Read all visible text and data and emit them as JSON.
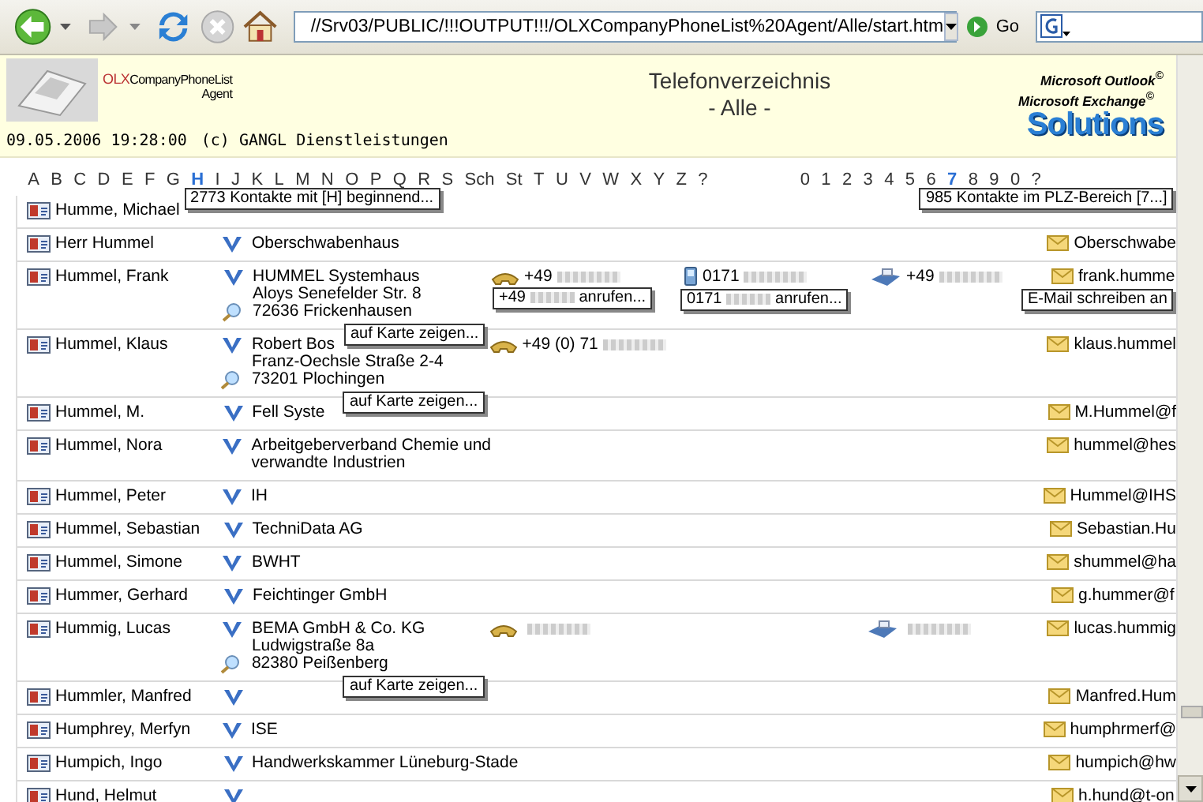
{
  "toolbar": {
    "address": "//Srv03/PUBLIC/!!!OUTPUT!!!/OLXCompanyPhoneList%20Agent/Alle/start.htm",
    "go": "Go"
  },
  "header": {
    "brand_prefix": "OLX",
    "brand": "CompanyPhoneList",
    "brand_sub": "Agent",
    "title": "Telefonverzeichnis",
    "subtitle": "- Alle -",
    "timestamp": "09.05.2006 19:28:00",
    "copyright": "(c) GANGL Dienstleistungen",
    "partner_lines": [
      "Microsoft Outlook$^{©}$",
      "Microsoft Exchange$^{©}$"
    ],
    "partner_name": "Solutions"
  },
  "letters": [
    {
      "label": "A",
      "selected": false
    },
    {
      "label": "B",
      "selected": false
    },
    {
      "label": "C",
      "selected": false
    },
    {
      "label": "D",
      "selected": false
    },
    {
      "label": "E",
      "selected": false
    },
    {
      "label": "F",
      "selected": false
    },
    {
      "label": "G",
      "selected": false
    },
    {
      "label": "H",
      "selected": true,
      "tooltip": "2773 Kontakte mit [H] beginnend..."
    },
    {
      "label": "I",
      "selected": false
    },
    {
      "label": "J",
      "selected": false
    },
    {
      "label": "K",
      "selected": false
    },
    {
      "label": "L",
      "selected": false
    },
    {
      "label": "M",
      "selected": false
    },
    {
      "label": "N",
      "selected": false
    },
    {
      "label": "O",
      "selected": false
    },
    {
      "label": "P",
      "selected": false
    },
    {
      "label": "Q",
      "selected": false
    },
    {
      "label": "R",
      "selected": false
    },
    {
      "label": "S",
      "selected": false
    },
    {
      "label": "Sch",
      "selected": false
    },
    {
      "label": "St",
      "selected": false
    },
    {
      "label": "T",
      "selected": false
    },
    {
      "label": "U",
      "selected": false
    },
    {
      "label": "V",
      "selected": false
    },
    {
      "label": "W",
      "selected": false
    },
    {
      "label": "X",
      "selected": false
    },
    {
      "label": "Y",
      "selected": false
    },
    {
      "label": "Z",
      "selected": false
    },
    {
      "label": "?",
      "selected": false
    }
  ],
  "digits": [
    {
      "label": "0",
      "selected": false
    },
    {
      "label": "1",
      "selected": false
    },
    {
      "label": "2",
      "selected": false
    },
    {
      "label": "3",
      "selected": false
    },
    {
      "label": "4",
      "selected": false
    },
    {
      "label": "5",
      "selected": false
    },
    {
      "label": "6",
      "selected": false
    },
    {
      "label": "7",
      "selected": true,
      "tooltip": "985 Kontakte im PLZ-Bereich [7...]"
    },
    {
      "label": "8",
      "selected": false
    },
    {
      "label": "9",
      "selected": false
    },
    {
      "label": "0",
      "selected": false
    },
    {
      "label": "?",
      "selected": false
    }
  ],
  "contacts": [
    {
      "name": "Humme, Michael"
    },
    {
      "name": "Herr Hummel",
      "company": {
        "lines": [
          "Oberschwabenhaus"
        ],
        "map": false
      },
      "email": {
        "text": "Oberschwabe"
      }
    },
    {
      "name": "Hummel, Frank",
      "company": {
        "lines": [
          "HUMMEL Systemhaus",
          "Aloys Senefelder Str. 8",
          "72636 Frickenhausen"
        ],
        "map": true,
        "map_tooltip": "auf Karte zeigen..."
      },
      "phone": {
        "text": "+49",
        "redacted": true,
        "tooltip": {
          "text": "+49",
          "redacted": true,
          "suffix": "anrufen..."
        }
      },
      "mobile": {
        "text": "0171",
        "redacted": true,
        "tooltip": {
          "text": "0171",
          "redacted": true,
          "suffix": "anrufen..."
        }
      },
      "fax": {
        "text": "+49",
        "redacted": true
      },
      "email": {
        "text": "frank.humme",
        "tooltip": "E-Mail schreiben an"
      }
    },
    {
      "name": "Hummel, Klaus",
      "company": {
        "lines": [
          "Robert Bos",
          "Franz-Oechsle Straße 2-4",
          "73201 Plochingen"
        ],
        "map": true,
        "map_tooltip": "auf Karte zeigen..."
      },
      "phone": {
        "text": "+49 (0) 71",
        "redacted": true
      },
      "email": {
        "text": "klaus.hummel"
      }
    },
    {
      "name": "Hummel, M.",
      "company": {
        "lines": [
          "Fell Syste"
        ],
        "map": false
      },
      "email": {
        "text": "M.Hummel@f"
      }
    },
    {
      "name": "Hummel, Nora",
      "company": {
        "lines": [
          "Arbeitgeberverband Chemie und",
          "verwandte Industrien"
        ],
        "map": false
      },
      "email": {
        "text": "hummel@hes"
      }
    },
    {
      "name": "Hummel, Peter",
      "company": {
        "lines": [
          "IH"
        ],
        "map": false
      },
      "email": {
        "text": "Hummel@IHS"
      }
    },
    {
      "name": "Hummel, Sebastian",
      "company": {
        "lines": [
          "TechniData AG"
        ],
        "map": false
      },
      "email": {
        "text": "Sebastian.Hu"
      }
    },
    {
      "name": "Hummel, Simone",
      "company": {
        "lines": [
          "BWHT"
        ],
        "map": false
      },
      "email": {
        "text": "shummel@ha"
      }
    },
    {
      "name": "Hummer, Gerhard",
      "company": {
        "lines": [
          "Feichtinger GmbH"
        ],
        "map": false
      },
      "email": {
        "text": "g.hummer@f"
      }
    },
    {
      "name": "Hummig, Lucas",
      "company": {
        "lines": [
          "BEMA GmbH & Co. KG",
          "Ludwigstraße 8a",
          "82380 Peißenberg"
        ],
        "map": true,
        "map_tooltip": "auf Karte zeigen..."
      },
      "phone": {
        "redacted": true
      },
      "fax": {
        "redacted": true
      },
      "email": {
        "text": "lucas.hummig"
      }
    },
    {
      "name": "Hummler, Manfred",
      "company": {
        "map": false
      },
      "email": {
        "text": "Manfred.Hum"
      }
    },
    {
      "name": "Humphrey, Merfyn",
      "company": {
        "lines": [
          "ISE"
        ],
        "map": false
      },
      "email": {
        "text": "humphrmerf@"
      }
    },
    {
      "name": "Humpich, Ingo",
      "company": {
        "lines": [
          "Handwerkskammer Lüneburg-Stade"
        ],
        "map": false
      },
      "email": {
        "text": "humpich@hw"
      }
    },
    {
      "name": "Hund, Helmut",
      "company": {
        "map": false
      },
      "email": {
        "text": "h.hund@t-on"
      }
    }
  ]
}
